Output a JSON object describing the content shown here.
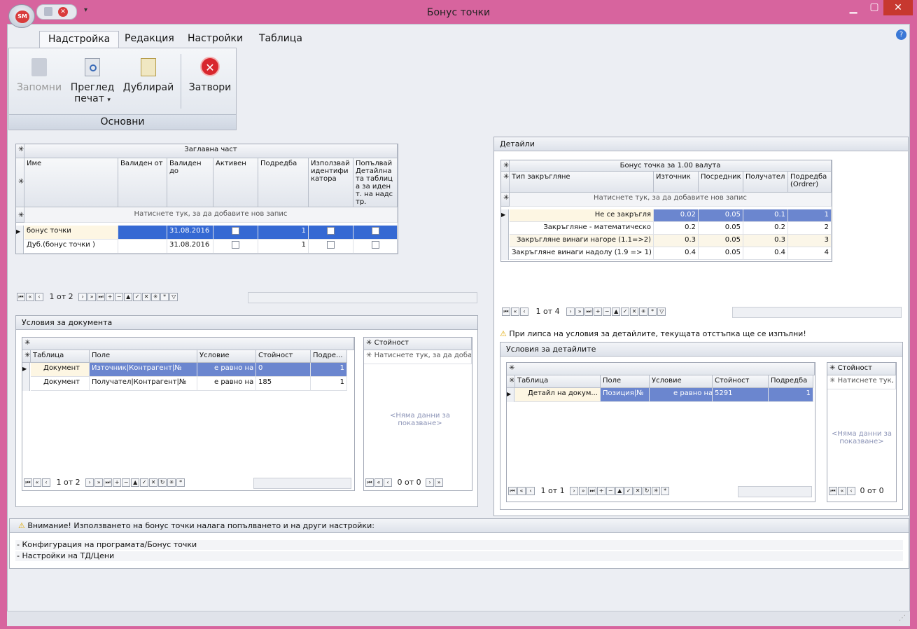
{
  "window": {
    "title": "Бонус точки",
    "logo": "SM"
  },
  "tabs": [
    "Надстройка",
    "Редакция",
    "Настройки",
    "Таблица"
  ],
  "ribbon": {
    "save": "Запомни",
    "preview1": "Преглед",
    "preview2": "печат",
    "duplicate": "Дублирай",
    "close": "Затвори",
    "group": "Основни"
  },
  "header": {
    "group_title": "Заглавна част",
    "columns": [
      "Име",
      "Валиден от",
      "Валиден до",
      "Активен",
      "Подредба",
      "Използвай идентификатора",
      "Попълвай Детайлната таблица за идент. на надстр."
    ],
    "new_row": "Натиснете тук, за да добавите нов запис",
    "rows": [
      {
        "name": "бонус точки",
        "from": "",
        "to": "31.08.2016",
        "active": true,
        "order": "1",
        "use": true,
        "fill": true
      },
      {
        "name": "Дуб.(бонус точки )",
        "from": "",
        "to": "31.08.2016",
        "active": false,
        "order": "1",
        "use": false,
        "fill": false
      }
    ],
    "nav": "1 от 2"
  },
  "details": {
    "title": "Детайли",
    "group_title": "Бонус точка за 1.00 валута",
    "columns": [
      "Тип закръгляне",
      "Източник",
      "Посредник",
      "Получател",
      "Подредба (Ordrer)"
    ],
    "new_row": "Натиснете тук, за да добавите нов запис",
    "rows": [
      [
        "Не се закръгля",
        "0.02",
        "0.05",
        "0.1",
        "1"
      ],
      [
        "Закръгляне - математическо",
        "0.2",
        "0.05",
        "0.2",
        "2"
      ],
      [
        "Закръгляне винаги нагоре (1.1=>2)",
        "0.3",
        "0.05",
        "0.3",
        "3"
      ],
      [
        "Закръгляне винаги надолу (1.9 => 1)",
        "0.4",
        "0.05",
        "0.4",
        "4"
      ]
    ],
    "nav": "1 от 4",
    "warning": "При липса на условия за детайлите, текущата отстъпка ще се изпълни!"
  },
  "doc_conditions": {
    "title": "Условия за документа",
    "columns": [
      "Таблица",
      "Поле",
      "Условие",
      "Стойност",
      "Подре..."
    ],
    "rows": [
      [
        "Документ",
        "Източник|Контрагент|№",
        "е равно на",
        "0",
        "1"
      ],
      [
        "Документ",
        "Получател|Контрагент|№",
        "е равно на",
        "185",
        "1"
      ]
    ],
    "nav": "1 от 2",
    "value_header": "Стойност",
    "value_new": "Натиснете тук, за да добав",
    "nodata": "<Няма данни за показване>",
    "value_nav": "0 от 0"
  },
  "det_conditions": {
    "title": "Условия за детайлите",
    "columns": [
      "Таблица",
      "Поле",
      "Условие",
      "Стойност",
      "Подредба"
    ],
    "rows": [
      [
        "Детайл на докум...",
        "Позиция|№",
        "е равно на",
        "5291",
        "1"
      ]
    ],
    "nav": "1 от 1",
    "value_header": "Стойност",
    "value_new": "Натиснете тук, з",
    "nodata": "<Няма данни за показване>",
    "value_nav": "0 от 0"
  },
  "bottom": {
    "warning": "Внимание! Използването на бонус точки налага попълването и на други настройки:",
    "items": [
      "- Конфигурация на програмата/Бонус точки",
      "- Настройки на ТД/Цени"
    ]
  }
}
